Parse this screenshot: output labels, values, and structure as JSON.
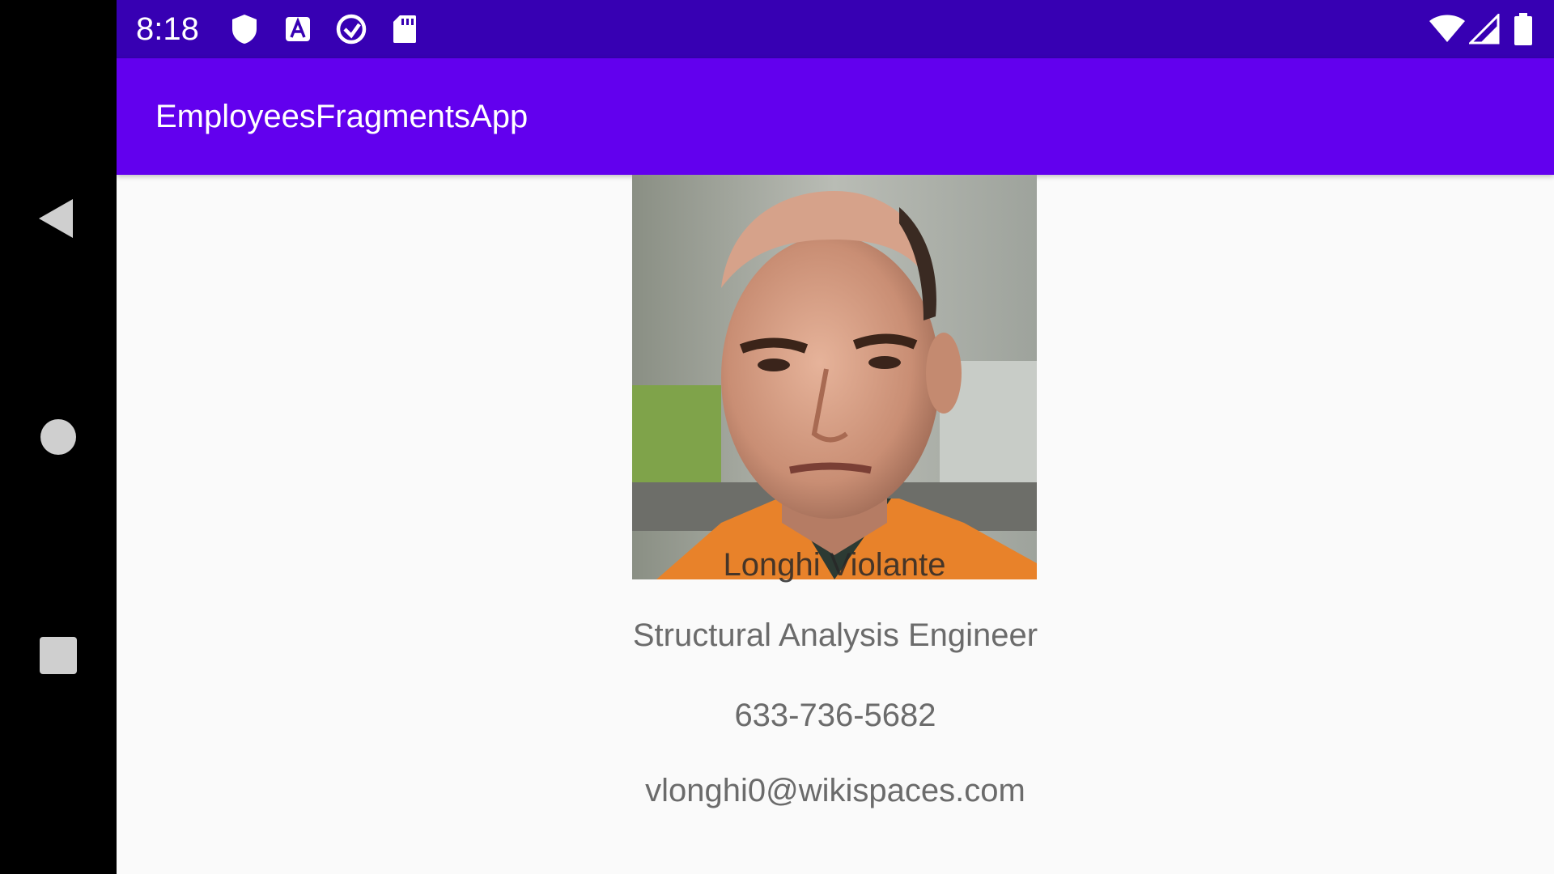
{
  "status_bar": {
    "time": "8:18",
    "left_icons": [
      "shield-icon",
      "a-badge-icon",
      "sync-circle-icon",
      "sd-card-icon"
    ],
    "right_icons": [
      "wifi-icon",
      "signal-icon",
      "battery-icon"
    ]
  },
  "app_bar": {
    "title": "EmployeesFragmentsApp"
  },
  "employee": {
    "name": "Longhi Violante",
    "job_title": "Structural Analysis Engineer",
    "phone": "633-736-5682",
    "email": "vlonghi0@wikispaces.com"
  },
  "navigation": {
    "buttons": [
      "back-icon",
      "home-icon",
      "recents-icon"
    ]
  },
  "colors": {
    "status_bar": "#3700b3",
    "app_bar": "#6200ee",
    "background": "#fafafa"
  }
}
